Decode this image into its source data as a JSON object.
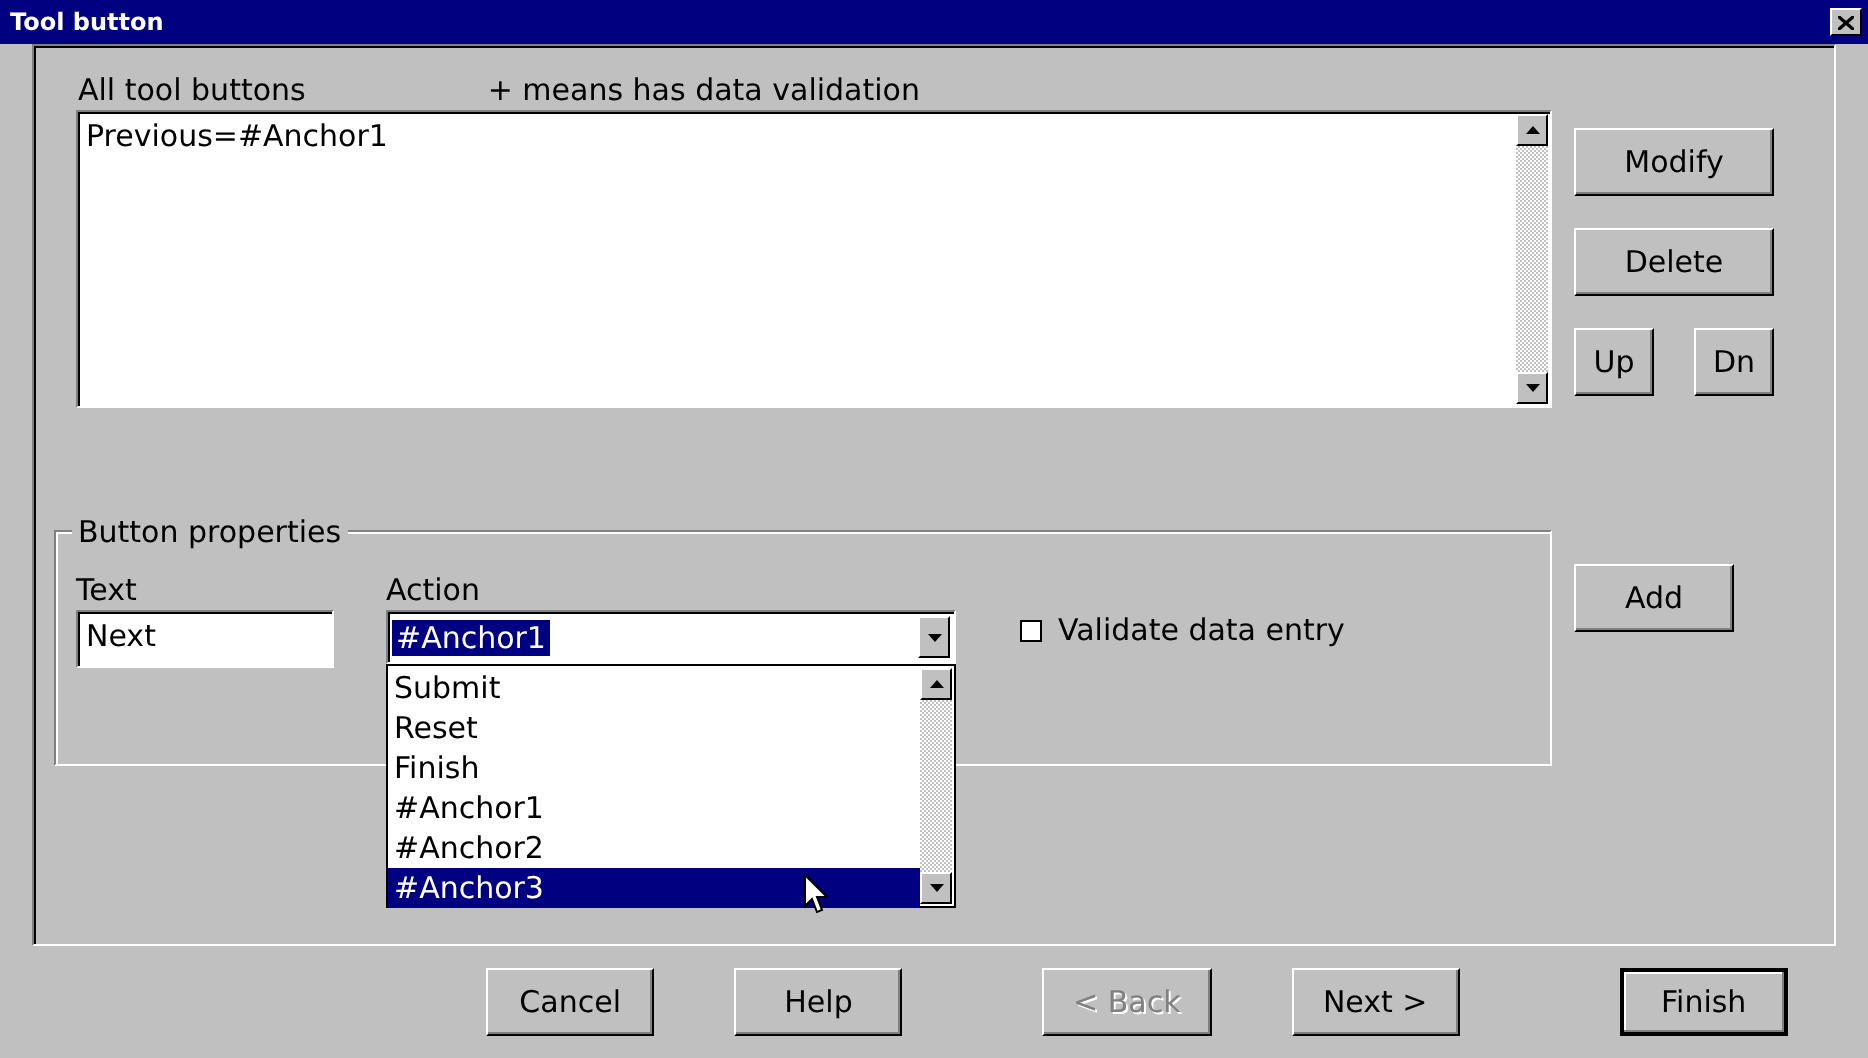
{
  "window": {
    "title": "Tool button"
  },
  "list": {
    "label": "All tool buttons",
    "note": "+ means has data validation",
    "items": [
      "Previous=#Anchor1"
    ]
  },
  "side_buttons": [
    {
      "label": "Modify",
      "kind": "wide"
    },
    {
      "label": "Delete",
      "kind": "wide"
    },
    {
      "label": "Up",
      "kind": "small"
    },
    {
      "label": "Dn",
      "kind": "small"
    }
  ],
  "properties": {
    "title": "Button properties",
    "text_label": "Text",
    "text_value": "Next",
    "action_label": "Action",
    "action_value": "#Anchor1",
    "expanded": true,
    "options": [
      {
        "label": "Submit",
        "selected": false
      },
      {
        "label": "Reset",
        "selected": false
      },
      {
        "label": "Finish",
        "selected": false
      },
      {
        "label": "#Anchor1",
        "selected": false
      },
      {
        "label": "#Anchor2",
        "selected": false
      },
      {
        "label": "#Anchor3",
        "selected": true
      }
    ],
    "checkbox": {
      "label": "Validate data entry",
      "checked": false
    }
  },
  "add_button": "Add",
  "buttons": [
    {
      "label": "Cancel",
      "disabled": false,
      "default": false
    },
    {
      "label": "Help",
      "disabled": false,
      "default": false
    },
    {
      "label": "< Back",
      "disabled": true,
      "default": false
    },
    {
      "label": "Next >",
      "disabled": false,
      "default": false
    },
    {
      "label": "Finish",
      "disabled": false,
      "default": true
    }
  ]
}
